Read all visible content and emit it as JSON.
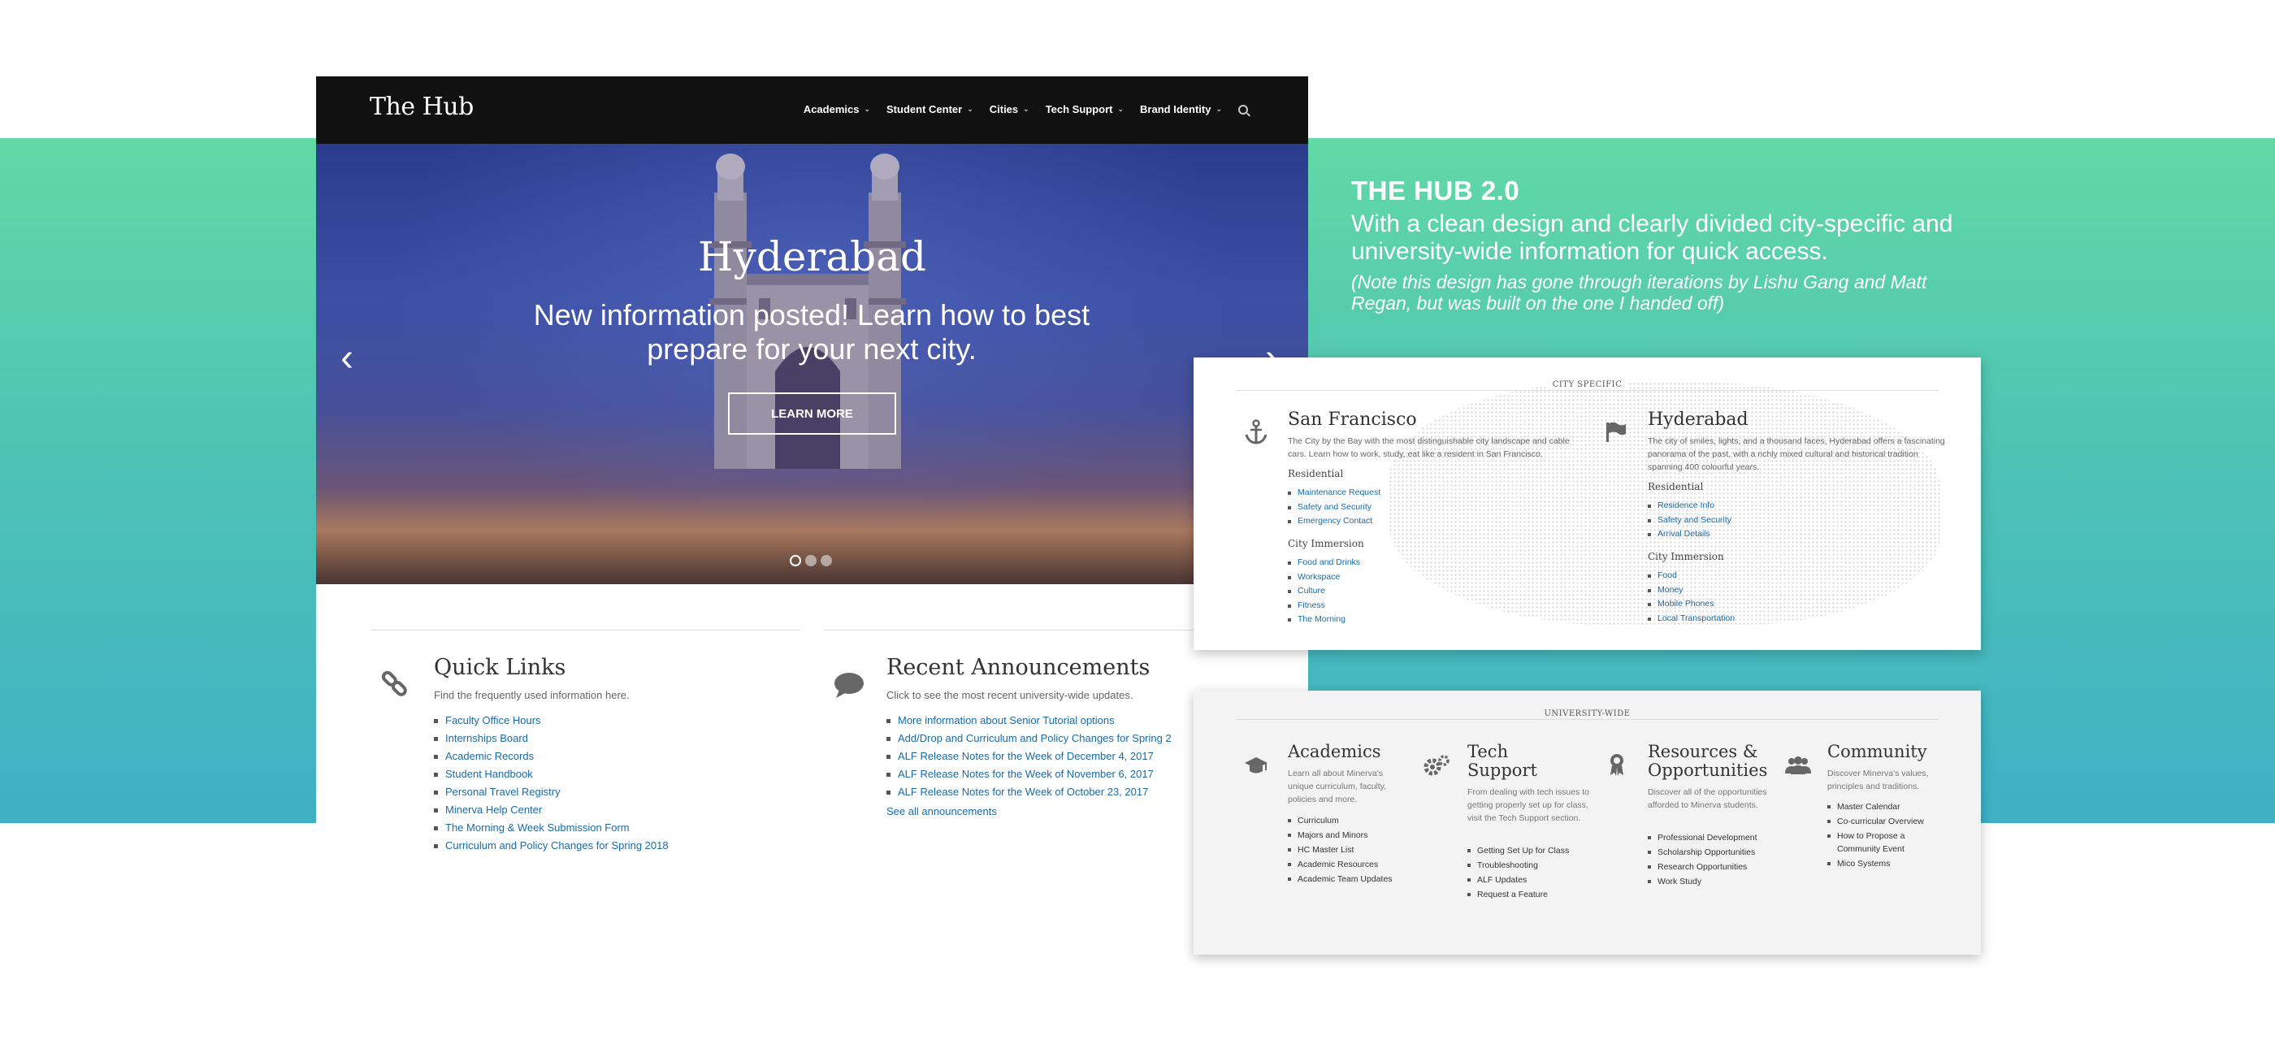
{
  "colors": {
    "band_top": "#62d9a6",
    "band_bottom": "#3fb0c6",
    "link": "#1a6aa6",
    "nav_bg": "#111111"
  },
  "site": {
    "logo": "The Hub",
    "nav": [
      {
        "label": "Academics"
      },
      {
        "label": "Student Center"
      },
      {
        "label": "Cities"
      },
      {
        "label": "Tech Support"
      },
      {
        "label": "Brand Identity"
      }
    ],
    "nav_icon": "search-icon",
    "hero": {
      "title": "Hyderabad",
      "subtitle": "New information posted! Learn how to best prepare for your next city.",
      "button": "LEARN MORE",
      "slide_count": 3,
      "active_slide": 1
    },
    "quick_links": {
      "title": "Quick Links",
      "desc": "Find the frequently used information here.",
      "icon": "link-icon",
      "items": [
        "Faculty Office Hours",
        "Internships Board",
        "Academic Records",
        "Student Handbook",
        "Personal Travel Registry",
        "Minerva Help Center",
        "The Morning & Week Submission Form",
        "Curriculum and Policy Changes for Spring 2018"
      ]
    },
    "announcements": {
      "title": "Recent Announcements",
      "desc": "Click to see the most recent university-wide updates.",
      "icon": "speech-bubble-icon",
      "items": [
        "More information about Senior Tutorial options",
        "Add/Drop and Curriculum and Policy Changes for Spring 2",
        "ALF Release Notes for the Week of December 4, 2017",
        "ALF Release Notes for the Week of November 6, 2017",
        "ALF Release Notes for the Week of October 23, 2017"
      ],
      "see_all": "See all announcements"
    }
  },
  "info": {
    "heading": "THE HUB 2.0",
    "body": "With a clean design and clearly divided city-specific and university-wide information for quick access.",
    "note": "(Note this design has gone through iterations by Lishu Gang and Matt Regan, but was built on the one I handed off)"
  },
  "city_panel": {
    "heading": "CITY SPECIFIC",
    "cities": [
      {
        "name": "San Francisco",
        "icon": "anchor-icon",
        "desc": "The City by the Bay with the most distinguishable city landscape and cable cars. Learn how to work, study, eat like a resident in San Francisco.",
        "residential_label": "Residential",
        "residential": [
          "Maintenance Request",
          "Safety and Security",
          "Emergency Contact"
        ],
        "immersion_label": "City Immersion",
        "immersion": [
          "Food and Drinks",
          "Workspace",
          "Culture",
          "Fitness",
          "The Morning"
        ]
      },
      {
        "name": "Hyderabad",
        "icon": "flag-icon",
        "desc": "The city of smiles, lights, and a thousand faces, Hyderabad offers a fascinating panorama of the past, with a richly mixed cultural and historical tradition spanning 400 colourful years.",
        "residential_label": "Residential",
        "residential": [
          "Residence Info",
          "Safety and Security",
          "Arrival Details"
        ],
        "immersion_label": "City Immersion",
        "immersion": [
          "Food",
          "Money",
          "Mobile Phones",
          "Local Transportation"
        ]
      }
    ]
  },
  "univ_panel": {
    "heading": "UNIVERSITY-WIDE",
    "columns": [
      {
        "title": "Academics",
        "icon": "graduation-cap-icon",
        "desc": "Learn all about Minerva's unique curriculum, faculty, policies and more.",
        "items": [
          "Curriculum",
          "Majors and Minors",
          "HC Master List",
          "Academic Resources",
          "Academic Team Updates"
        ]
      },
      {
        "title": "Tech Support",
        "icon": "gears-icon",
        "desc": "From dealing with tech issues to getting properly set up for class, visit the Tech Support section.",
        "items": [
          "Getting Set Up for Class",
          "Troubleshooting",
          "ALF Updates",
          "Request a Feature"
        ]
      },
      {
        "title": "Resources & Opportunities",
        "icon": "award-ribbon-icon",
        "desc": "Discover all of the opportunities afforded to Minerva students.",
        "items": [
          "Professional Development",
          "Scholarship Opportunities",
          "Research Opportunities",
          "Work Study"
        ]
      },
      {
        "title": "Community",
        "icon": "people-icon",
        "desc": "Discover Minerva's values, principles and traditions.",
        "items": [
          "Master Calendar",
          "Co-curricular Overview",
          "How to Propose a Community Event",
          "Mico Systems"
        ]
      }
    ]
  }
}
